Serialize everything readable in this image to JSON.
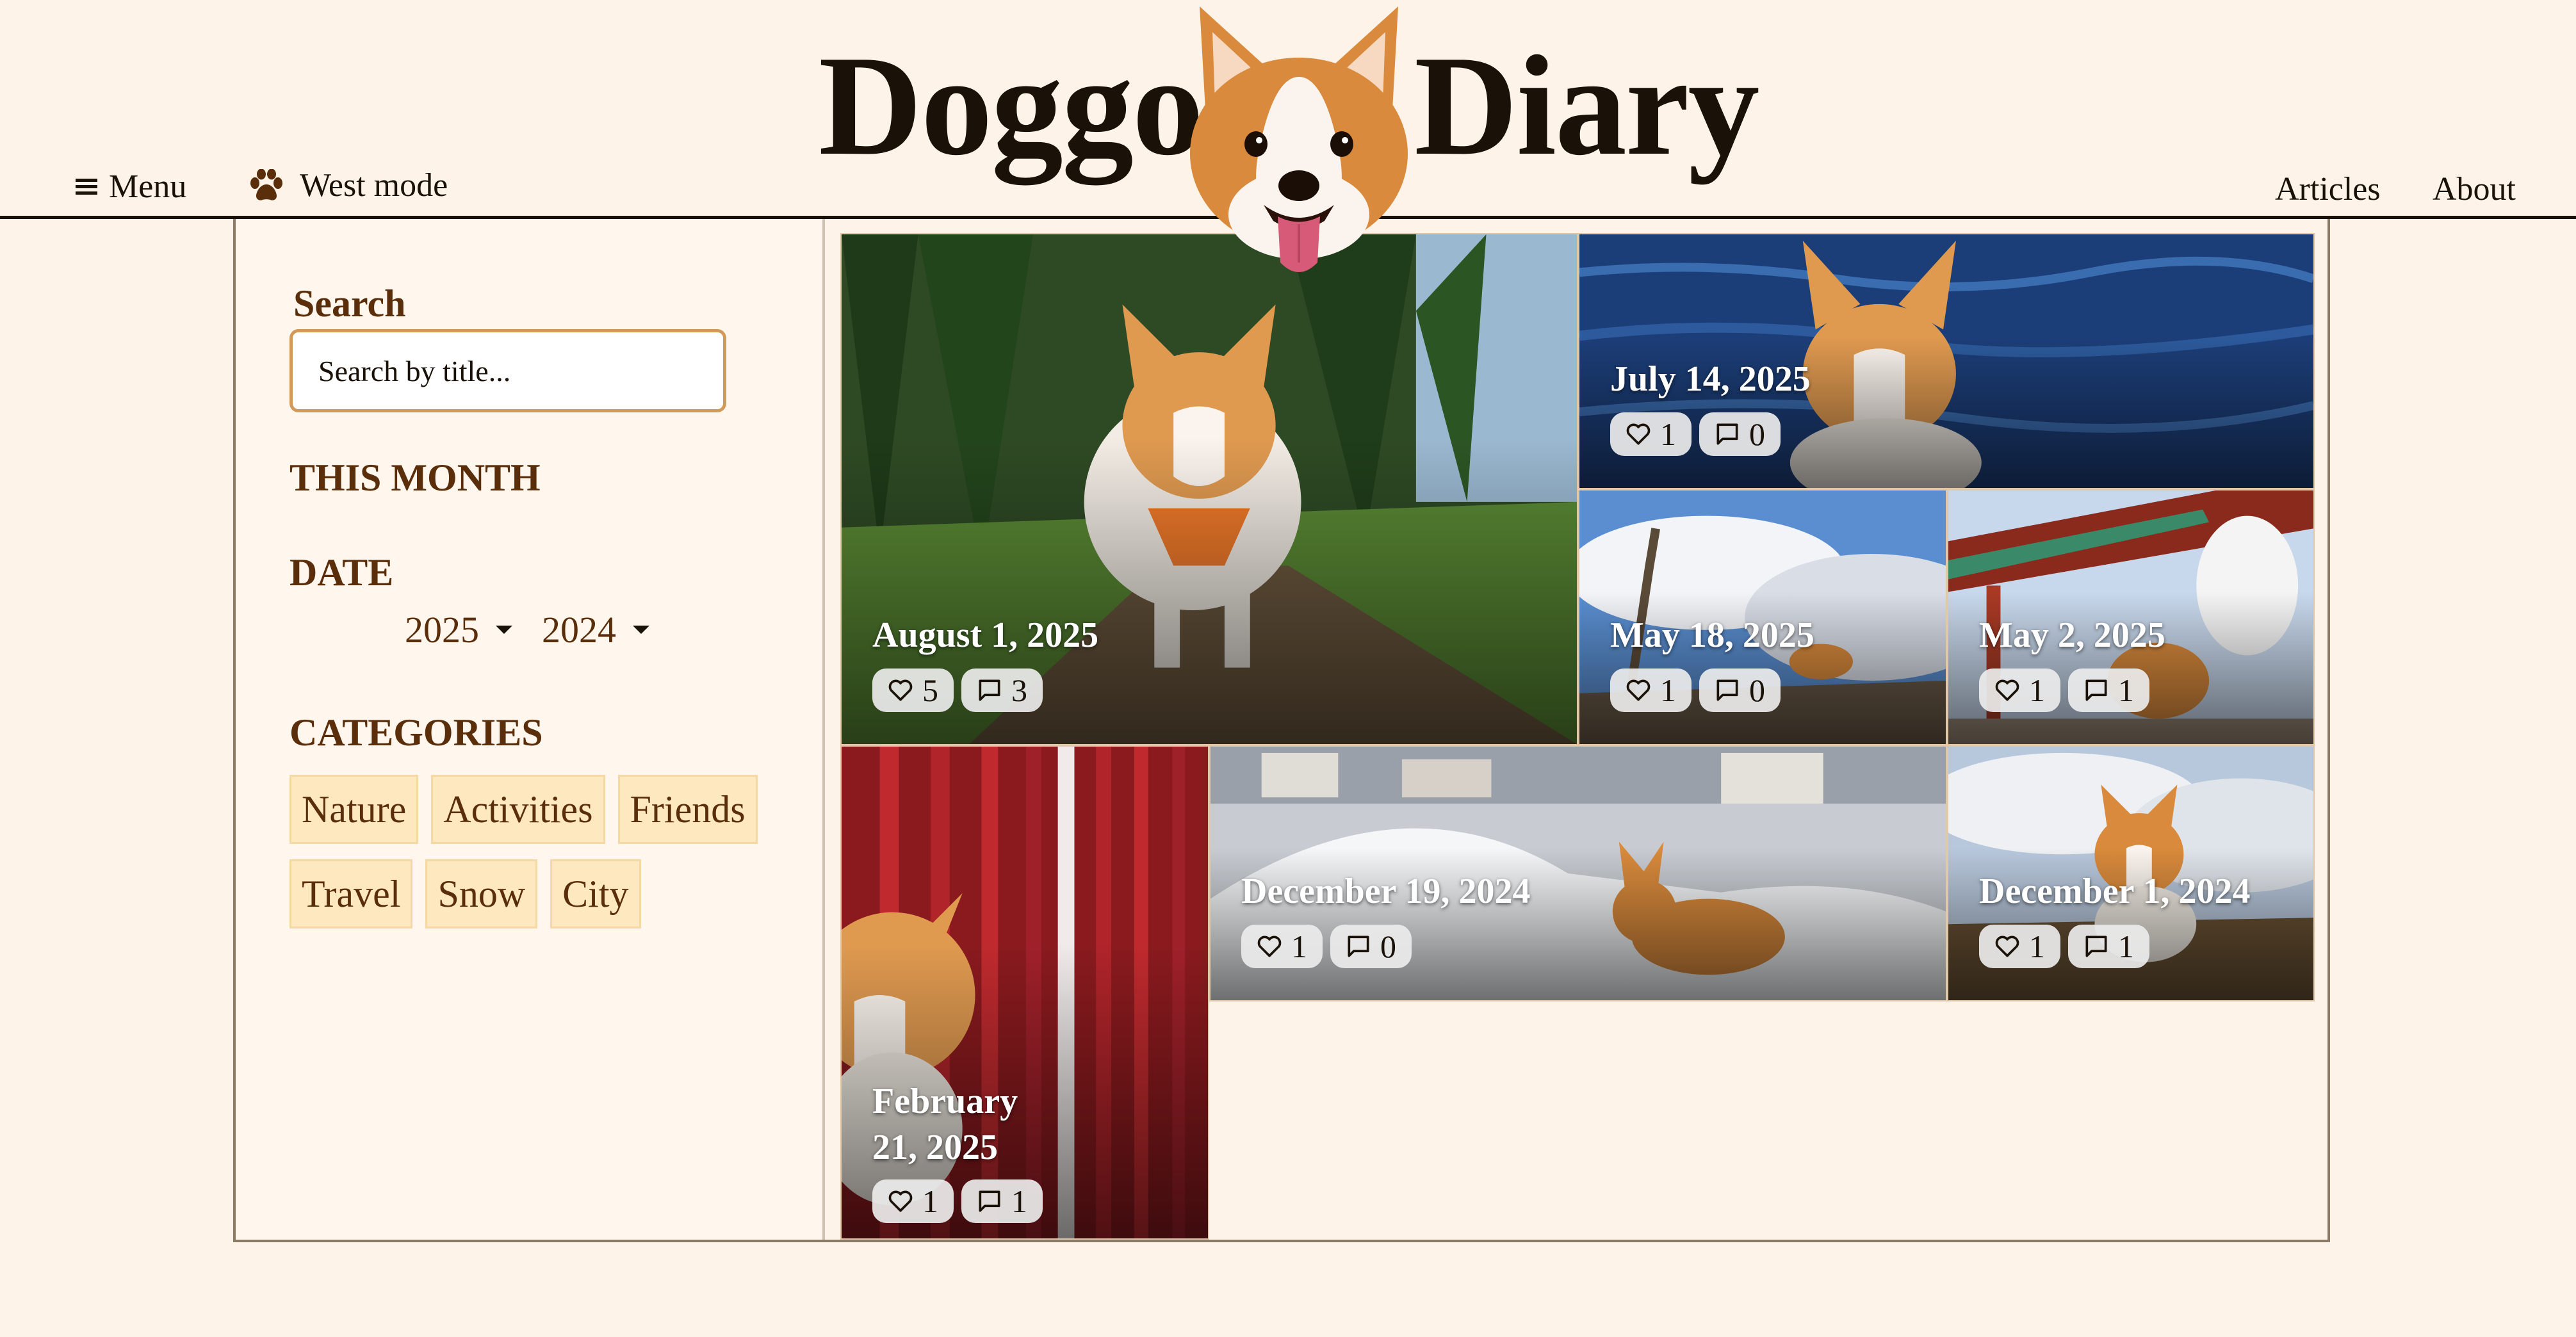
{
  "header": {
    "menu_label": "Menu",
    "mode_label": "West mode",
    "brand_left": "Doggo",
    "brand_right": "Diary",
    "nav": {
      "articles": "Articles",
      "about": "About"
    }
  },
  "sidebar": {
    "search_label": "Search",
    "search_placeholder": "Search by title...",
    "this_month_label": "THIS MONTH",
    "date_label": "DATE",
    "years": [
      "2025",
      "2024"
    ],
    "categories_label": "CATEGORIES",
    "categories": [
      "Nature",
      "Activities",
      "Friends",
      "Travel",
      "Snow",
      "City"
    ]
  },
  "posts": [
    {
      "date": "August 1, 2025",
      "likes": "5",
      "comments": "3",
      "scene": "forest"
    },
    {
      "date": "July 14, 2025",
      "likes": "1",
      "comments": "0",
      "scene": "water"
    },
    {
      "date": "May 18, 2025",
      "likes": "1",
      "comments": "0",
      "scene": "sky"
    },
    {
      "date": "May 2, 2025",
      "likes": "1",
      "comments": "1",
      "scene": "temple"
    },
    {
      "date": "February 21, 2025",
      "likes": "1",
      "comments": "1",
      "scene": "red-fence"
    },
    {
      "date": "December 19, 2024",
      "likes": "1",
      "comments": "0",
      "scene": "snow"
    },
    {
      "date": "December 1, 2024",
      "likes": "1",
      "comments": "1",
      "scene": "meadow"
    }
  ],
  "colors": {
    "page_bg": "#fdf3e8",
    "sidebar_bg": "#fff7ee",
    "heading_brown": "#5a2e0a",
    "tag_bg": "#fde8c0",
    "search_border": "#d29a58"
  },
  "icons": {
    "menu": "hamburger-icon",
    "mode": "paw-icon",
    "like": "heart-icon",
    "comment": "comment-icon"
  }
}
